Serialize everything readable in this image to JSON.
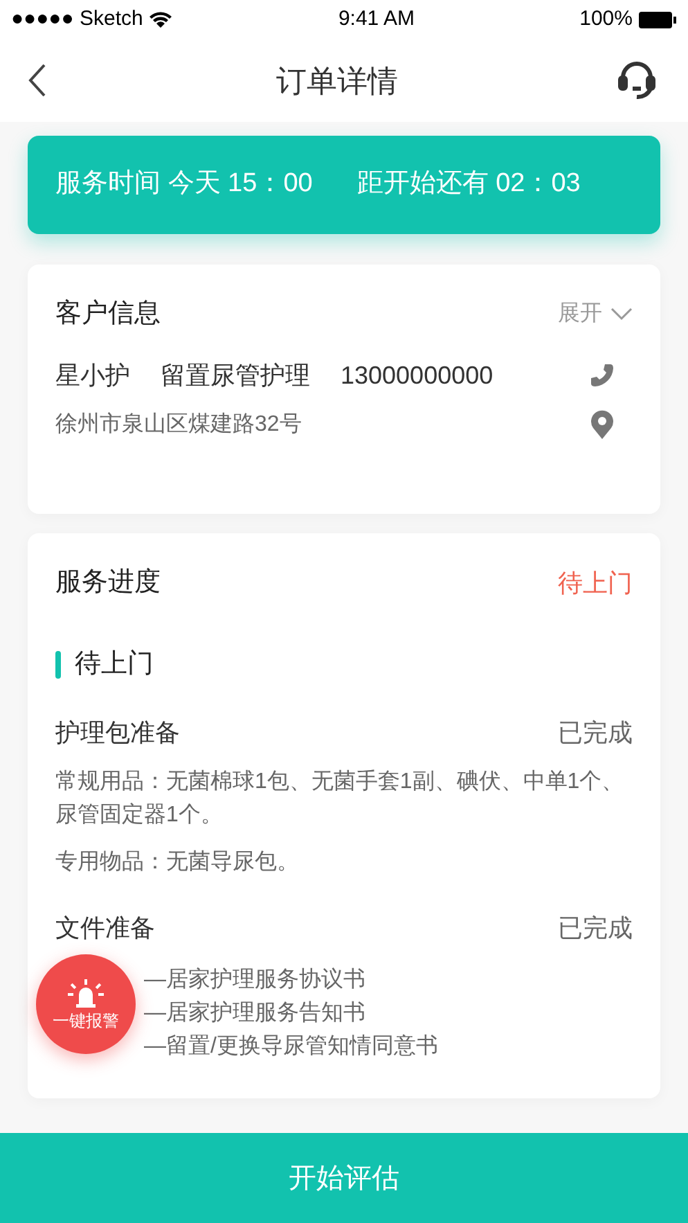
{
  "status_bar": {
    "carrier": "●●●●● Sketch",
    "time": "9:41 AM",
    "battery": "100%"
  },
  "nav": {
    "title": "订单详情"
  },
  "banner": {
    "service_time": "服务时间 今天 15：00",
    "countdown": "距开始还有 02：03"
  },
  "customer": {
    "title": "客户信息",
    "toggle": "展开",
    "expanded": false,
    "name": "星小护",
    "service": "留置尿管护理",
    "phone": "13000000000",
    "address": "徐州市泉山区煤建路32号"
  },
  "progress": {
    "title": "服务进度",
    "status": "待上门",
    "stage": "待上门",
    "tasks": [
      {
        "name": "护理包准备",
        "state": "已完成",
        "lines": [
          "常规用品：无菌棉球1包、无菌手套1副、碘伏、中单1个、尿管固定器1个。",
          "专用物品：无菌导尿包。"
        ]
      },
      {
        "name": "文件准备",
        "state": "已完成",
        "covered_lines": [
          "—居家护理服务协议书",
          "—居家护理服务告知书",
          "—留置/更换导尿管知情同意书"
        ]
      }
    ]
  },
  "alarm": {
    "label": "一键报警"
  },
  "action": {
    "label": "开始评估"
  }
}
